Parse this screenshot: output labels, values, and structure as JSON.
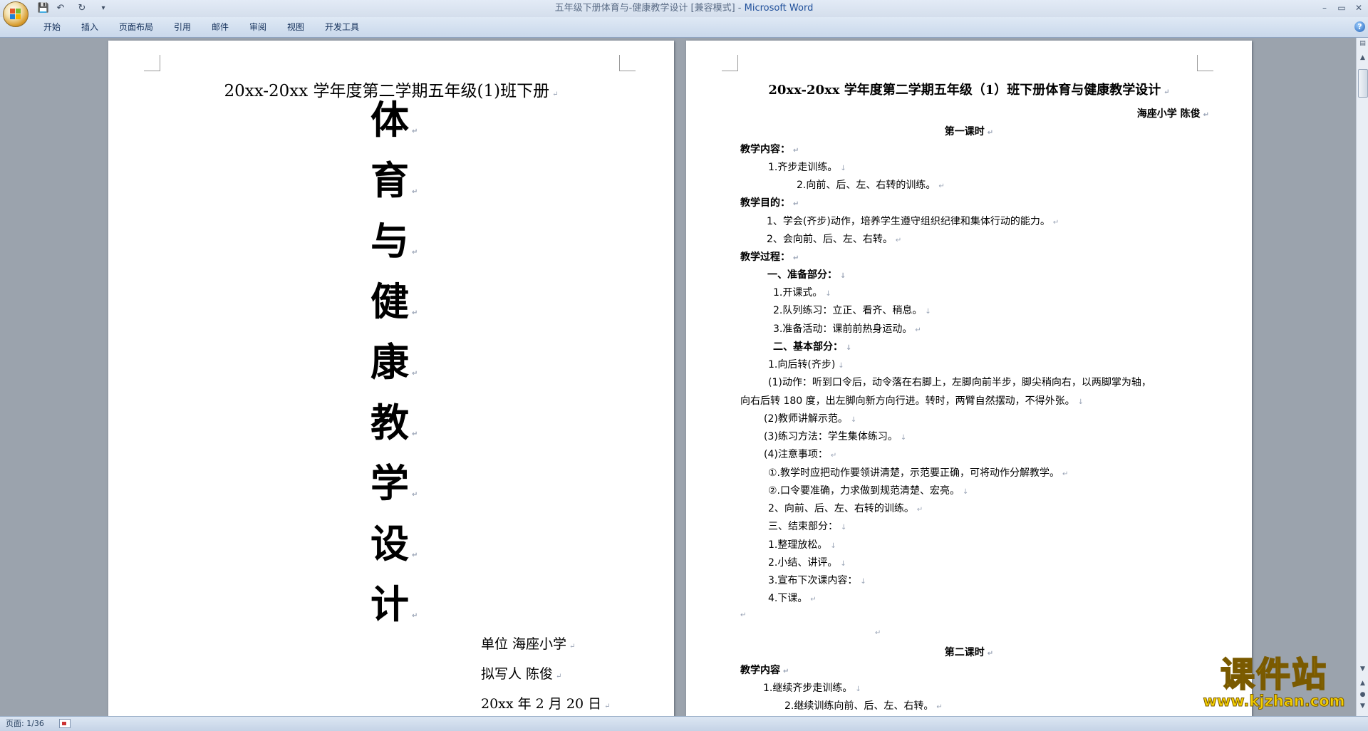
{
  "window": {
    "title": "五年级下册体育与-健康教学设计 [兼容模式]",
    "app_name": "Microsoft Word",
    "title_sep": " - ",
    "controls": [
      "–",
      "▭",
      "✕"
    ]
  },
  "quick_access": {
    "save": "💾",
    "undo": "↶",
    "redo": "↻",
    "customize": "▾"
  },
  "ribbon": {
    "tabs": [
      "开始",
      "插入",
      "页面布局",
      "引用",
      "邮件",
      "审阅",
      "视图",
      "开发工具"
    ],
    "help": "?"
  },
  "page1": {
    "header": "20xx-20xx 学年度第二学期五年级(1)班下册",
    "title_chars": [
      "体",
      "育",
      "与",
      "健",
      "康",
      "教",
      "学",
      "设",
      "计"
    ],
    "sign_unit": "单位  海座小学",
    "sign_writer": "拟写人  陈俊",
    "sign_date": "20xx 年 2 月 20 日"
  },
  "page2": {
    "title": "20xx-20xx 学年度第二学期五年级（1）班下册体育与健康教学设计",
    "author": "海座小学    陈俊",
    "lesson1_heading": "第一课时",
    "l01": "教学内容：",
    "l02": "1.齐步走训练。",
    "l03": "2.向前、后、左、右转的训练。",
    "l04": "教学目的：",
    "l05": "1、学会(齐步)动作，培养学生遵守组织纪律和集体行动的能力。",
    "l06": "2、会向前、后、左、右转。",
    "l07": "教学过程：",
    "l08": "一、准备部分：",
    "l09": "1.开课式。",
    "l10": "2.队列练习：立正、看齐、稍息。",
    "l11": "3.准备活动：课前前热身运动。",
    "l12": "二、基本部分：",
    "l13": "1.向后转(齐步)",
    "l14": "(1)动作：听到口令后，动令落在右脚上，左脚向前半步，脚尖稍向右，以两脚掌为轴，",
    "l15": "向右后转 180 度，出左脚向新方向行进。转时，两臂自然摆动，不得外张。",
    "l16": "(2)教师讲解示范。",
    "l17": "(3)练习方法：学生集体练习。",
    "l18": "(4)注意事项：",
    "l19": "①.教学时应把动作要领讲清楚，示范要正确，可将动作分解教学。",
    "l20": "②.口令要准确，力求做到规范清楚、宏亮。",
    "l21": "2、向前、后、左、右转的训练。",
    "l22": "三、结束部分：",
    "l23": "1.整理放松。",
    "l24": "2.小结、讲评。",
    "l25": "3.宣布下次课内容：",
    "l26": "4.下课。",
    "lesson2_heading": "第二课时",
    "l27": "教学内容",
    "l28": "1.继续齐步走训练。",
    "l29": "2.继续训练向前、后、左、右转。"
  },
  "marks": {
    "para": "↵",
    "line": "↓"
  },
  "status": {
    "page": "页面: 1/36"
  },
  "watermark": {
    "main": "课件站",
    "url": "www.kjzhan.com"
  },
  "colors": {
    "workspace_bg": "#9ba3ad",
    "watermark_fill": "#f5d000",
    "app_name": "#1f4f9a"
  }
}
